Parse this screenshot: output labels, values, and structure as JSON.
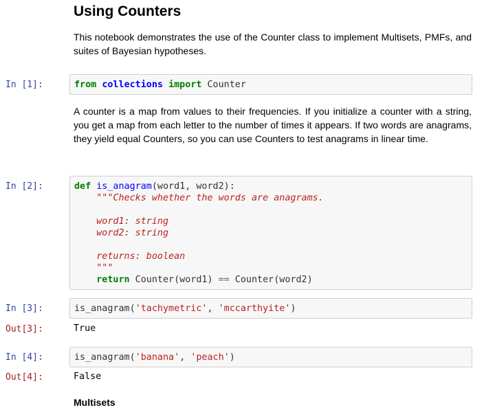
{
  "title": "Using Counters",
  "intro": "This notebook demonstrates the use of the Counter class to implement Multisets, PMFs, and suites of Bayesian hypotheses.",
  "explanation": "A counter is a map from values to their frequencies. If you initialize a counter with a string, you get a map from each letter to the number of times it appears. If two words are anagrams, they yield equal Counters, so you can use Counters to test anagrams in linear time.",
  "cells": [
    {
      "prompt": "In [1]:",
      "lines": [
        [
          [
            "from",
            "kw"
          ],
          [
            " ",
            ""
          ],
          [
            "collections",
            "nn"
          ],
          [
            " ",
            ""
          ],
          [
            "import",
            "kw"
          ],
          [
            " Counter",
            ""
          ]
        ]
      ]
    },
    {
      "prompt": "In [2]:",
      "lines": [
        [
          [
            "def",
            "kw"
          ],
          [
            " ",
            ""
          ],
          [
            "is_anagram",
            "fn"
          ],
          [
            "(word1, word2):",
            ""
          ]
        ],
        [
          [
            "    ",
            ""
          ],
          [
            "\"\"\"Checks whether the words are anagrams.",
            "doc"
          ]
        ],
        [
          [
            "",
            ""
          ]
        ],
        [
          [
            "    ",
            ""
          ],
          [
            "word1: string",
            "doc"
          ]
        ],
        [
          [
            "    ",
            ""
          ],
          [
            "word2: string",
            "doc"
          ]
        ],
        [
          [
            "",
            ""
          ]
        ],
        [
          [
            "    ",
            ""
          ],
          [
            "returns: boolean",
            "doc"
          ]
        ],
        [
          [
            "    ",
            ""
          ],
          [
            "\"\"\"",
            "doc"
          ]
        ],
        [
          [
            "    ",
            ""
          ],
          [
            "return",
            "kw"
          ],
          [
            " Counter(word1) ",
            ""
          ],
          [
            "==",
            "op"
          ],
          [
            " Counter(word2)",
            ""
          ]
        ]
      ]
    },
    {
      "prompt": "In [3]:",
      "lines": [
        [
          [
            "is_anagram(",
            ""
          ],
          [
            "'tachymetric'",
            "st"
          ],
          [
            ", ",
            ""
          ],
          [
            "'mccarthyite'",
            "st"
          ],
          [
            ")",
            ""
          ]
        ]
      ],
      "out_prompt": "Out[3]:",
      "output": "True"
    },
    {
      "prompt": "In [4]:",
      "lines": [
        [
          [
            "is_anagram(",
            ""
          ],
          [
            "'banana'",
            "st"
          ],
          [
            ", ",
            ""
          ],
          [
            "'peach'",
            "st"
          ],
          [
            ")",
            ""
          ]
        ]
      ],
      "out_prompt": "Out[4]:",
      "output": "False"
    }
  ],
  "section_heading": "Multisets"
}
